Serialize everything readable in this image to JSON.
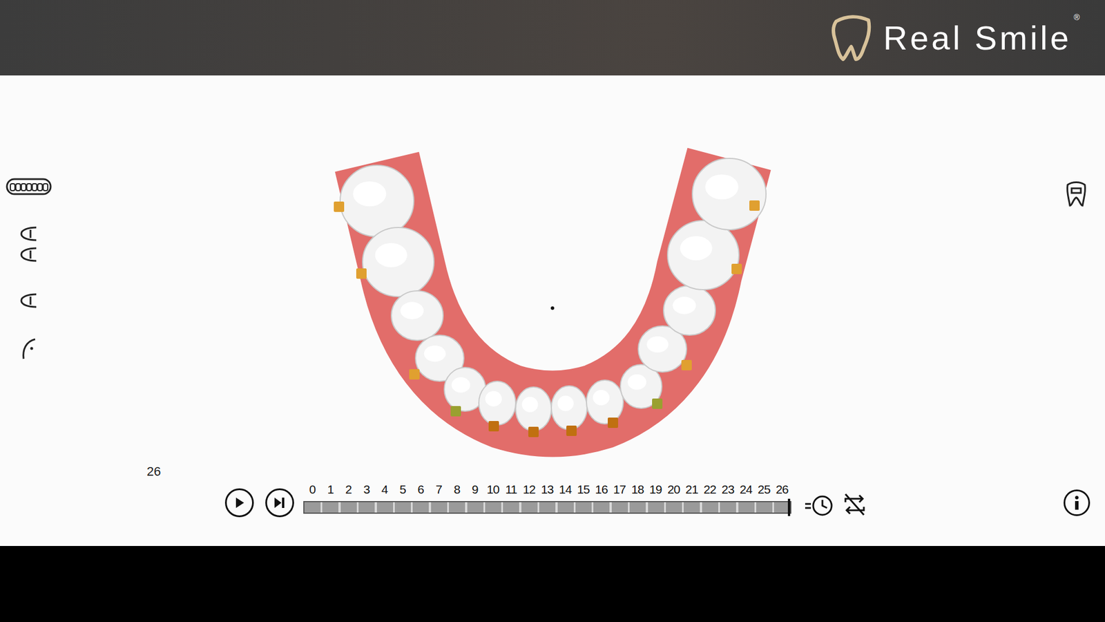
{
  "header": {
    "brand": "Real Smile",
    "trademark": "®"
  },
  "stage_label": "26",
  "timeline": {
    "steps": [
      "0",
      "1",
      "2",
      "3",
      "4",
      "5",
      "6",
      "7",
      "8",
      "9",
      "10",
      "11",
      "12",
      "13",
      "14",
      "15",
      "16",
      "17",
      "18",
      "19",
      "20",
      "21",
      "22",
      "23",
      "24",
      "25",
      "26"
    ],
    "level": 1
  }
}
